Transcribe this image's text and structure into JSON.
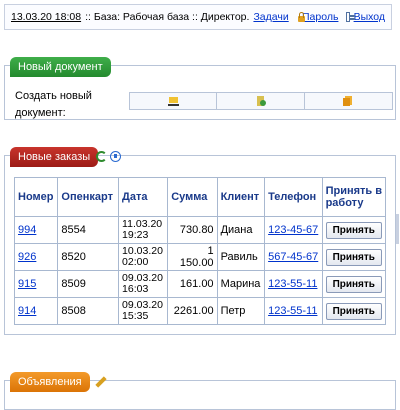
{
  "topbar": {
    "datetime": "13.03.20 18:08",
    "base": ":: База: Рабочая база :: Директор.",
    "tasks": "Задачи",
    "password": "Пароль",
    "exit": "Выход"
  },
  "new_document": {
    "title": "Новый документ",
    "label_line1": "Создать новый",
    "label_line2": "документ:",
    "buttons": [
      {
        "icon": "cart-icon"
      },
      {
        "icon": "document-icon"
      },
      {
        "icon": "stack-icon"
      }
    ]
  },
  "new_orders": {
    "title": "Новые заказы",
    "columns": [
      "Номер",
      "Опенкарт",
      "Дата",
      "Сумма",
      "Клиент",
      "Телефон",
      "Принять в работу"
    ],
    "rows": [
      {
        "num": "994",
        "oc": "8554",
        "date1": "11.03.20",
        "date2": "19:23",
        "sum": "730.80",
        "client": "Диана",
        "phone": "123-45-67",
        "action": "Принять"
      },
      {
        "num": "926",
        "oc": "8520",
        "date1": "10.03.20",
        "date2": "02:00",
        "sum": "1 150.00",
        "client": "Равиль",
        "phone": "567-45-67",
        "action": "Принять"
      },
      {
        "num": "915",
        "oc": "8509",
        "date1": "09.03.20",
        "date2": "16:03",
        "sum": "161.00",
        "client": "Марина",
        "phone": "123-55-11",
        "action": "Принять"
      },
      {
        "num": "914",
        "oc": "8508",
        "date1": "09.03.20",
        "date2": "15:35",
        "sum": "2261.00",
        "client": "Петр",
        "phone": "123-55-11",
        "action": "Принять"
      }
    ]
  },
  "announcements": {
    "title": "Объявления"
  }
}
